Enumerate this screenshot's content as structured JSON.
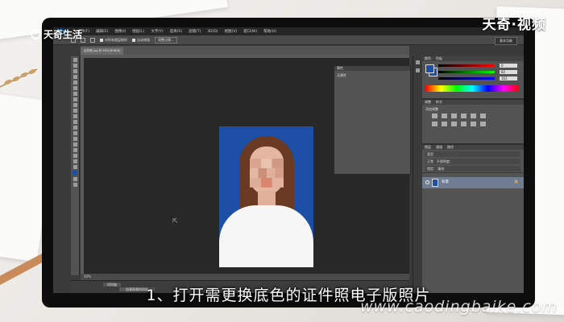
{
  "brand": {
    "left_logo_text": "天奇生活",
    "right_logo_text": "天奇·视频",
    "website": "www.caodingbaike.com"
  },
  "subtitle": "1、打开需更换底色的证件照电子版照片",
  "photoshop": {
    "menu_items": [
      "文件(F)",
      "编辑(E)",
      "图像(I)",
      "图层(L)",
      "文字(Y)",
      "选择(S)",
      "滤镜(T)",
      "3D(D)",
      "视图(V)",
      "窗口(W)",
      "帮助(H)"
    ],
    "options": {
      "checkbox1": "对所有图层取样",
      "checkbox2": "自动增强",
      "refine_button": "调整边缘...",
      "workspace": "基本功能"
    },
    "document_tab": "证件照.jpg @ 50%(RGB/8)",
    "status": "50%",
    "timeline_tab": "时间轴",
    "timeline_button": "创建视频时间轴",
    "properties": {
      "title": "属性",
      "subtitle": "无属性"
    },
    "color_panel": {
      "tabs": [
        "颜色",
        "色板"
      ],
      "r": "0",
      "g": "82",
      "b": "162",
      "fg_color": "#1c4fa5"
    },
    "adjustments": {
      "tabs": [
        "调整",
        "样式"
      ],
      "label": "添加调整"
    },
    "layers": {
      "tabs": [
        "图层",
        "通道",
        "路径"
      ],
      "kind": "类型",
      "blend": "正常",
      "opacity_label": "不透明度:",
      "lock_label": "锁定:",
      "fill_label": "填充:",
      "layer_name": "背景",
      "lock_icon": "lock-icon"
    }
  }
}
